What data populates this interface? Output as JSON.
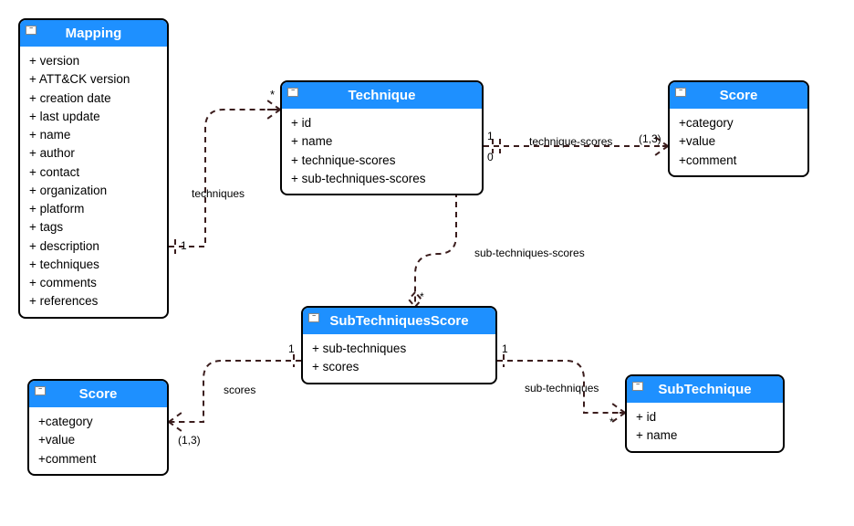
{
  "classes": {
    "mapping": {
      "name": "Mapping",
      "attrs": [
        "+ version",
        "+ ATT&CK version",
        "+ creation date",
        "+ last update",
        "+ name",
        "+ author",
        "+ contact",
        "+ organization",
        "+ platform",
        "+ tags",
        "+ description",
        "+ techniques",
        "+ comments",
        "+ references"
      ]
    },
    "technique": {
      "name": "Technique",
      "attrs": [
        "+ id",
        "+ name",
        "+ technique-scores",
        "+ sub-techniques-scores"
      ]
    },
    "score_top": {
      "name": "Score",
      "attrs": [
        "+category",
        "+value",
        "+comment"
      ]
    },
    "sts": {
      "name": "SubTechniquesScore",
      "attrs": [
        "+ sub-techniques",
        "+ scores"
      ]
    },
    "score_bottom": {
      "name": "Score",
      "attrs": [
        "+category",
        "+value",
        "+comment"
      ]
    },
    "subtechnique": {
      "name": "SubTechnique",
      "attrs": [
        "+ id",
        "+ name"
      ]
    }
  },
  "associations": {
    "techniques": {
      "label": "techniques",
      "end1": "1",
      "end2": "*"
    },
    "technique_scores": {
      "label": "technique-scores",
      "end1": "1\n0",
      "end2": "(1,3)"
    },
    "sub_techniques_scores": {
      "label": "sub-techniques-scores",
      "end1": "",
      "end2": "*"
    },
    "scores": {
      "label": "scores",
      "end1": "1",
      "end2": "(1,3)"
    },
    "sub_techniques": {
      "label": "sub-techniques",
      "end1": "1",
      "end2": "*"
    }
  },
  "chart_data": {
    "type": "uml-class-diagram",
    "classes": [
      {
        "name": "Mapping",
        "attributes": [
          "version",
          "ATT&CK version",
          "creation date",
          "last update",
          "name",
          "author",
          "contact",
          "organization",
          "platform",
          "tags",
          "description",
          "techniques",
          "comments",
          "references"
        ]
      },
      {
        "name": "Technique",
        "attributes": [
          "id",
          "name",
          "technique-scores",
          "sub-techniques-scores"
        ]
      },
      {
        "name": "Score",
        "attributes": [
          "category",
          "value",
          "comment"
        ]
      },
      {
        "name": "SubTechniquesScore",
        "attributes": [
          "sub-techniques",
          "scores"
        ]
      },
      {
        "name": "SubTechnique",
        "attributes": [
          "id",
          "name"
        ]
      }
    ],
    "associations": [
      {
        "label": "techniques",
        "from": "Mapping",
        "to": "Technique",
        "from_mult": "1",
        "to_mult": "*"
      },
      {
        "label": "technique-scores",
        "from": "Technique",
        "to": "Score",
        "from_mult": "1,0",
        "to_mult": "(1,3)"
      },
      {
        "label": "sub-techniques-scores",
        "from": "Technique",
        "to": "SubTechniquesScore",
        "from_mult": "",
        "to_mult": "*"
      },
      {
        "label": "scores",
        "from": "SubTechniquesScore",
        "to": "Score",
        "from_mult": "1",
        "to_mult": "(1,3)"
      },
      {
        "label": "sub-techniques",
        "from": "SubTechniquesScore",
        "to": "SubTechnique",
        "from_mult": "1",
        "to_mult": "*"
      }
    ]
  }
}
